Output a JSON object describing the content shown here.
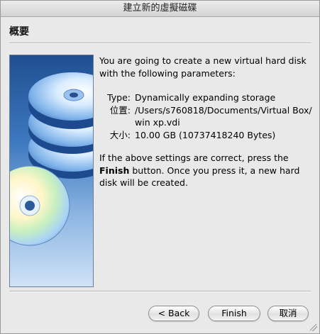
{
  "window": {
    "title": "建立新的虛擬磁碟"
  },
  "section": {
    "title": "概要"
  },
  "content": {
    "intro": "You are going to create a new virtual hard disk with the following parameters:",
    "params": [
      {
        "key": "Type:",
        "value": "Dynamically expanding storage"
      },
      {
        "key": "位置:",
        "value": "/Users/s760818/Documents/Virtual Box/win xp.vdi"
      },
      {
        "key": "大小:",
        "value": "10.00 GB (10737418240 Bytes)"
      }
    ],
    "note_before": "If the above settings are correct, press the ",
    "note_bold": "Finish",
    "note_after": " button. Once you press it, a new hard disk will be created."
  },
  "buttons": {
    "back": "< Back",
    "finish": "Finish",
    "cancel": "取消"
  },
  "icons": {
    "art": "stacked-disks-illustration",
    "grip": "resize-grip-icon"
  }
}
